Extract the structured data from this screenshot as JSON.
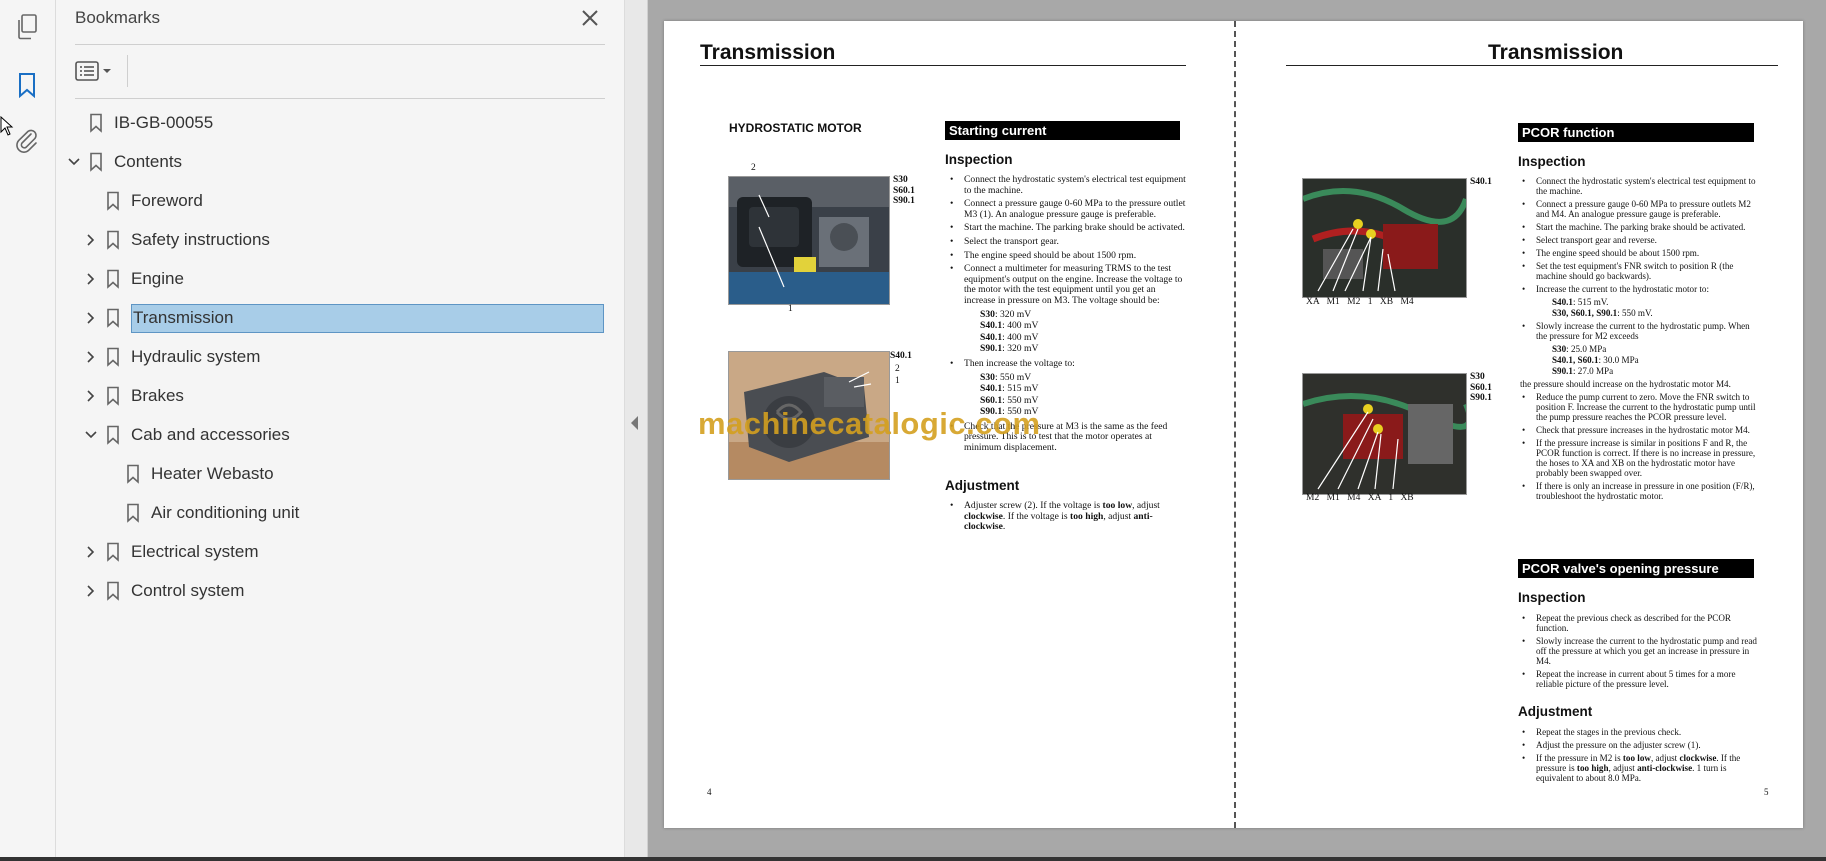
{
  "panel": {
    "title": "Bookmarks"
  },
  "bookmarks": [
    {
      "label": "IB-GB-00055",
      "level": 0,
      "expandable": false
    },
    {
      "label": "Contents",
      "level": 0,
      "expandable": true,
      "expanded": true
    },
    {
      "label": "Foreword",
      "level": 1,
      "expandable": false
    },
    {
      "label": "Safety instructions",
      "level": 1,
      "expandable": true
    },
    {
      "label": "Engine",
      "level": 1,
      "expandable": true
    },
    {
      "label": "Transmission",
      "level": 1,
      "expandable": true,
      "selected": true
    },
    {
      "label": "Hydraulic system",
      "level": 1,
      "expandable": true
    },
    {
      "label": "Brakes",
      "level": 1,
      "expandable": true
    },
    {
      "label": "Cab and accessories",
      "level": 1,
      "expandable": true,
      "expanded": true
    },
    {
      "label": "Heater Webasto",
      "level": 2,
      "expandable": false
    },
    {
      "label": "Air conditioning unit",
      "level": 2,
      "expandable": false
    },
    {
      "label": "Electrical system",
      "level": 1,
      "expandable": true
    },
    {
      "label": "Control system",
      "level": 1,
      "expandable": true
    }
  ],
  "icons": {
    "pages": "pages-icon",
    "bookmark": "bookmark-icon",
    "attachment": "paperclip-icon",
    "close": "close-icon",
    "options": "bookmark-options-icon"
  },
  "colors": {
    "selected_bg": "#a8cde8",
    "selected_border": "#5e95c4",
    "accent_blue": "#1a6fc4",
    "watermark": "#d4a020"
  },
  "left_page": {
    "header": "Transmission",
    "figure_title": "HYDROSTATIC MOTOR",
    "photo1_labels": {
      "top": "2",
      "bottom": "1",
      "models": [
        "S30",
        "S60.1",
        "S90.1"
      ]
    },
    "photo2_labels": {
      "model": "S40.1",
      "n2": "2",
      "n1": "1"
    },
    "section1": "Starting current",
    "inspection": "Inspection",
    "items": [
      "Connect the hydrostatic system's electrical test equipment to the machine.",
      "Connect a pressure gauge 0-60 MPa to the pressure outlet M3 (1). An analogue pressure gauge is preferable.",
      "Start the machine. The parking brake should be activated.",
      "Select the transport gear.",
      "The engine speed should be about 1500 rpm.",
      "Connect a multimeter for measuring TRMS to the test equipment's output on the engine. Increase the voltage to the motor with the test equipment until you get an increase in pressure on M3. The voltage should be:"
    ],
    "volts1": [
      {
        "m": "S30",
        "v": ": 320 mV"
      },
      {
        "m": "S40.1",
        "v": ": 400 mV"
      },
      {
        "m": "S40.1",
        "v": ": 400 mV"
      },
      {
        "m": "S90.1",
        "v": ": 320 mV"
      }
    ],
    "then_item": "Then increase the voltage to:",
    "volts2": [
      {
        "m": "S30",
        "v": ": 550 mV"
      },
      {
        "m": "S40.1",
        "v": ": 515 mV"
      },
      {
        "m": "S60.1",
        "v": ": 550 mV"
      },
      {
        "m": "S90.1",
        "v": ": 550 mV"
      }
    ],
    "check_item": "Check that the pressure at M3 is the same as the feed pressure. This is to test that the motor operates at minimum displacement.",
    "adjustment": "Adjustment",
    "adj_pre": "Adjuster screw (2). If the voltage is ",
    "adj_b1": "too low",
    "adj_mid1": ", adjust ",
    "adj_b2": "clockwise",
    "adj_mid2": ". If the voltage is ",
    "adj_b3": "too high",
    "adj_mid3": ", adjust ",
    "adj_b4": "anti-clockwise",
    "adj_end": ".",
    "page_number": "4"
  },
  "watermark": "machinecatalogic.com",
  "right_page": {
    "header": "Transmission",
    "photo1_model": "S40.1",
    "photo1_labels": [
      "XA",
      "M1",
      "M2",
      "1",
      "XB",
      "M4"
    ],
    "photo2_models": [
      "S30",
      "S60.1",
      "S90.1"
    ],
    "photo2_labels": [
      "M2",
      "M1",
      "M4",
      "XA",
      "1",
      "XB"
    ],
    "section1": "PCOR function",
    "inspection": "Inspection",
    "items": [
      "Connect the hydrostatic system's electrical test equipment to the machine.",
      "Connect a pressure gauge 0-60 MPa to pressure outlets M2 and M4. An analogue pressure gauge is preferable.",
      "Start the machine. The parking brake should be activated.",
      "Select transport gear and reverse.",
      "The engine speed should be about 1500 rpm.",
      "Set the test equipment's FNR switch to position R (the machine should go backwards).",
      "Increase the current to the hydrostatic motor to:"
    ],
    "currents": [
      {
        "m": "S40.1",
        "v": ": 515 mV."
      },
      {
        "m": "S30, S60.1, S90.1",
        "v": ": 550 mV."
      }
    ],
    "slowly_item": "Slowly increase the current to the hydrostatic pump. When the pressure for M2 exceeds",
    "pressures": [
      {
        "m": "S30",
        "v": ": 25.0 MPa"
      },
      {
        "m": "S40.1, S60.1",
        "v": ": 30.0 MPa"
      },
      {
        "m": "S90.1",
        "v": ": 27.0 MPa"
      }
    ],
    "pressure_note": "the pressure should increase on the hydrostatic motor M4.",
    "items2": [
      "Reduce the pump current to zero. Move the FNR switch to position F. Increase the current to the hydrostatic pump until the pump pressure reaches the PCOR pressure level.",
      "Check that pressure increases in the hydrostatic motor M4.",
      "If the pressure increase is similar in positions F and R, the PCOR function is correct. If there is no increase in pressure, the hoses to XA and XB on the hydrostatic motor have probably been swapped over.",
      "If there is only an increase in pressure in one position (F/R), troubleshoot the hydrostatic motor."
    ],
    "section2": "PCOR valve's opening pressure",
    "inspection2": "Inspection",
    "items3": [
      "Repeat the previous check as described for the PCOR function.",
      "Slowly increase the current to the hydrostatic pump and read off the pressure at which you get an increase in pressure in M4.",
      "Repeat the increase in current about 5 times for a more reliable picture of the pressure level."
    ],
    "adjustment": "Adjustment",
    "adj_items": [
      "Repeat the stages in the previous check.",
      "Adjust the pressure on the adjuster screw (1)."
    ],
    "adj_last_pre": "If the pressure in M2 is ",
    "adj_last_b1": "too low",
    "adj_last_mid1": ", adjust ",
    "adj_last_b2": "clockwise",
    "adj_last_mid2": ". If the pressure is ",
    "adj_last_b3": "too high",
    "adj_last_mid3": ", adjust ",
    "adj_last_b4": "anti-clockwise",
    "adj_last_end": ". 1 turn is equivalent to about 8.0 MPa.",
    "page_number": "5"
  }
}
